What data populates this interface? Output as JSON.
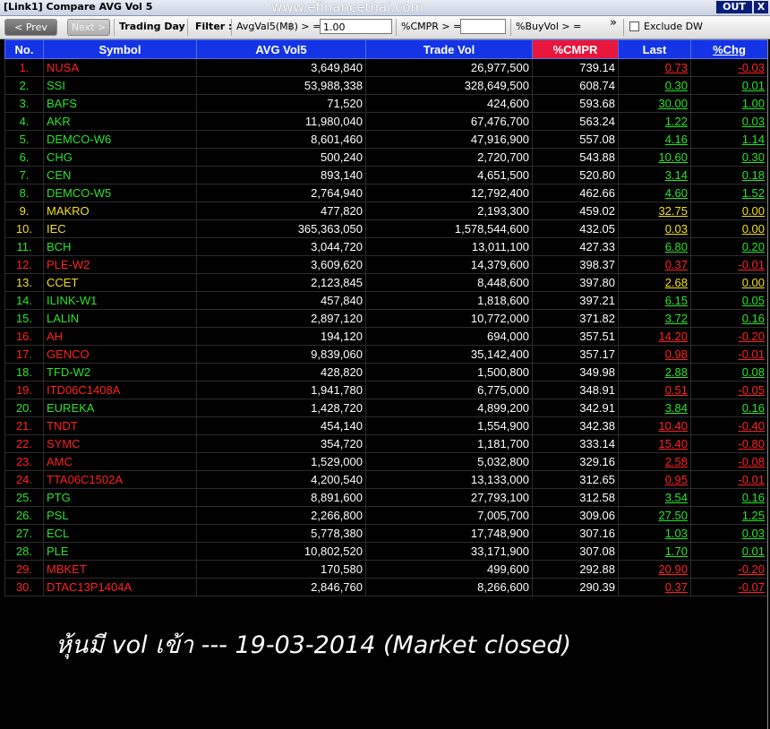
{
  "window": {
    "title": "[Link1] Compare AVG Vol 5",
    "watermark": "www.efinancethai.com",
    "out_label": "OUT",
    "close_label": "X"
  },
  "toolbar": {
    "prev_label": "< Prev",
    "next_label": "Next >",
    "trading_day_label": "Trading Day",
    "filter_label": "Filter :",
    "avgvol_label": "AvgVal5(M฿) > =",
    "avgvol_value": "1.00",
    "cmpr_label": "%CMPR > =",
    "cmpr_value": "",
    "buyvol_label": "%BuyVol > =",
    "more_label": "»",
    "exclude_dw_label": "Exclude DW"
  },
  "columns": [
    "No.",
    "Symbol",
    "AVG Vol5",
    "Trade Vol",
    "%CMPR",
    "Last",
    "%Chg"
  ],
  "rows": [
    {
      "no": "1.",
      "symbol": "NUSA",
      "avg": "3,649,840",
      "trade": "26,977,500",
      "cmpr": "739.14",
      "last": "0.73",
      "chg": "-0.03",
      "color": "red"
    },
    {
      "no": "2.",
      "symbol": "SSI",
      "avg": "53,988,338",
      "trade": "328,649,500",
      "cmpr": "608.74",
      "last": "0.30",
      "chg": "0.01",
      "color": "green"
    },
    {
      "no": "3.",
      "symbol": "BAFS",
      "avg": "71,520",
      "trade": "424,600",
      "cmpr": "593.68",
      "last": "30.00",
      "chg": "1.00",
      "color": "green"
    },
    {
      "no": "4.",
      "symbol": "AKR",
      "avg": "11,980,040",
      "trade": "67,476,700",
      "cmpr": "563.24",
      "last": "1.22",
      "chg": "0.03",
      "color": "green"
    },
    {
      "no": "5.",
      "symbol": "DEMCO-W6",
      "avg": "8,601,460",
      "trade": "47,916,900",
      "cmpr": "557.08",
      "last": "4.16",
      "chg": "1.14",
      "color": "green"
    },
    {
      "no": "6.",
      "symbol": "CHG",
      "avg": "500,240",
      "trade": "2,720,700",
      "cmpr": "543.88",
      "last": "10.60",
      "chg": "0.30",
      "color": "green"
    },
    {
      "no": "7.",
      "symbol": "CEN",
      "avg": "893,140",
      "trade": "4,651,500",
      "cmpr": "520.80",
      "last": "3.14",
      "chg": "0.18",
      "color": "green"
    },
    {
      "no": "8.",
      "symbol": "DEMCO-W5",
      "avg": "2,764,940",
      "trade": "12,792,400",
      "cmpr": "462.66",
      "last": "4.60",
      "chg": "1.52",
      "color": "green"
    },
    {
      "no": "9.",
      "symbol": "MAKRO",
      "avg": "477,820",
      "trade": "2,193,300",
      "cmpr": "459.02",
      "last": "32.75",
      "chg": "0.00",
      "color": "yellow"
    },
    {
      "no": "10.",
      "symbol": "IEC",
      "avg": "365,363,050",
      "trade": "1,578,544,600",
      "cmpr": "432.05",
      "last": "0.03",
      "chg": "0.00",
      "color": "yellow"
    },
    {
      "no": "11.",
      "symbol": "BCH",
      "avg": "3,044,720",
      "trade": "13,011,100",
      "cmpr": "427.33",
      "last": "6.80",
      "chg": "0.20",
      "color": "green"
    },
    {
      "no": "12.",
      "symbol": "PLE-W2",
      "avg": "3,609,620",
      "trade": "14,379,600",
      "cmpr": "398.37",
      "last": "0.37",
      "chg": "-0.01",
      "color": "red"
    },
    {
      "no": "13.",
      "symbol": "CCET",
      "avg": "2,123,845",
      "trade": "8,448,600",
      "cmpr": "397.80",
      "last": "2.68",
      "chg": "0.00",
      "color": "yellow"
    },
    {
      "no": "14.",
      "symbol": "ILINK-W1",
      "avg": "457,840",
      "trade": "1,818,600",
      "cmpr": "397.21",
      "last": "6.15",
      "chg": "0.05",
      "color": "green"
    },
    {
      "no": "15.",
      "symbol": "LALIN",
      "avg": "2,897,120",
      "trade": "10,772,000",
      "cmpr": "371.82",
      "last": "3.72",
      "chg": "0.16",
      "color": "green"
    },
    {
      "no": "16.",
      "symbol": "AH",
      "avg": "194,120",
      "trade": "694,000",
      "cmpr": "357.51",
      "last": "14.20",
      "chg": "-0.20",
      "color": "red"
    },
    {
      "no": "17.",
      "symbol": "GENCO",
      "avg": "9,839,060",
      "trade": "35,142,400",
      "cmpr": "357.17",
      "last": "0.98",
      "chg": "-0.01",
      "color": "red"
    },
    {
      "no": "18.",
      "symbol": "TFD-W2",
      "avg": "428,820",
      "trade": "1,500,800",
      "cmpr": "349.98",
      "last": "2.88",
      "chg": "0.08",
      "color": "green"
    },
    {
      "no": "19.",
      "symbol": "ITD06C1408A",
      "avg": "1,941,780",
      "trade": "6,775,000",
      "cmpr": "348.91",
      "last": "0.51",
      "chg": "-0.05",
      "color": "red"
    },
    {
      "no": "20.",
      "symbol": "EUREKA",
      "avg": "1,428,720",
      "trade": "4,899,200",
      "cmpr": "342.91",
      "last": "3.84",
      "chg": "0.16",
      "color": "green"
    },
    {
      "no": "21.",
      "symbol": "TNDT",
      "avg": "454,140",
      "trade": "1,554,900",
      "cmpr": "342.38",
      "last": "10.40",
      "chg": "-0.40",
      "color": "red"
    },
    {
      "no": "22.",
      "symbol": "SYMC",
      "avg": "354,720",
      "trade": "1,181,700",
      "cmpr": "333.14",
      "last": "15.40",
      "chg": "-0.80",
      "color": "red"
    },
    {
      "no": "23.",
      "symbol": "AMC",
      "avg": "1,529,000",
      "trade": "5,032,800",
      "cmpr": "329.16",
      "last": "2.58",
      "chg": "-0.08",
      "color": "red"
    },
    {
      "no": "24.",
      "symbol": "TTA06C1502A",
      "avg": "4,200,540",
      "trade": "13,133,000",
      "cmpr": "312.65",
      "last": "0.95",
      "chg": "-0.01",
      "color": "red"
    },
    {
      "no": "25.",
      "symbol": "PTG",
      "avg": "8,891,600",
      "trade": "27,793,100",
      "cmpr": "312.58",
      "last": "3.54",
      "chg": "0.16",
      "color": "green"
    },
    {
      "no": "26.",
      "symbol": "PSL",
      "avg": "2,266,800",
      "trade": "7,005,700",
      "cmpr": "309.06",
      "last": "27.50",
      "chg": "1.25",
      "color": "green"
    },
    {
      "no": "27.",
      "symbol": "ECL",
      "avg": "5,778,380",
      "trade": "17,748,900",
      "cmpr": "307.16",
      "last": "1.03",
      "chg": "0.03",
      "color": "green"
    },
    {
      "no": "28.",
      "symbol": "PLE",
      "avg": "10,802,520",
      "trade": "33,171,900",
      "cmpr": "307.08",
      "last": "1.70",
      "chg": "0.01",
      "color": "green"
    },
    {
      "no": "29.",
      "symbol": "MBKET",
      "avg": "170,580",
      "trade": "499,600",
      "cmpr": "292.88",
      "last": "20.90",
      "chg": "-0.20",
      "color": "red"
    },
    {
      "no": "30.",
      "symbol": "DTAC13P1404A",
      "avg": "2,846,760",
      "trade": "8,266,600",
      "cmpr": "290.39",
      "last": "0.37",
      "chg": "-0.07",
      "color": "red"
    }
  ],
  "caption": "หุ้นมี vol เข้า --- 19-03-2014 (Market closed)",
  "colors": {
    "red": "#ff2020",
    "green": "#28e428",
    "yellow": "#f0e020",
    "header": "#1434e6",
    "sorted_header": "#e8163c"
  }
}
